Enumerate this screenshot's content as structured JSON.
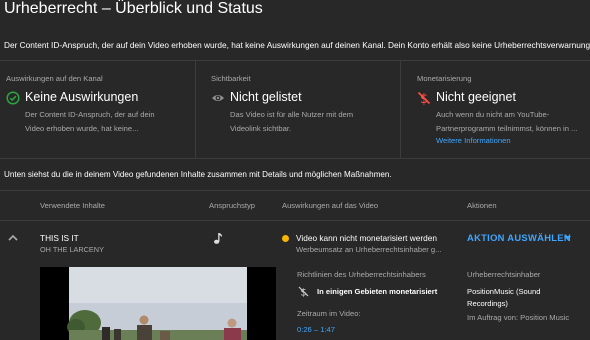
{
  "page": {
    "title": "Urheberrecht – Überblick und Status",
    "intro": "Der Content ID-Anspruch, der auf dein Video erhoben wurde, hat keine Auswirkungen auf deinen Kanal. Dein Konto erhält also keine Urheberrechtsverwarnung.",
    "found_text": "Unten siehst du die in deinem Video gefundenen Inhalte zusammen mit Details und möglichen Maßnahmen."
  },
  "cards": {
    "channel": {
      "heading": "Auswirkungen auf den Kanal",
      "icon": "check-circle-icon",
      "title": "Keine Auswirkungen",
      "desc_line1": "Der Content ID-Anspruch, der auf dein",
      "desc_line2": "Video erhoben wurde, hat keine..."
    },
    "visibility": {
      "heading": "Sichtbarkeit",
      "icon": "eye-icon",
      "title": "Nicht gelistet",
      "desc_line1": "Das Video ist für alle Nutzer mit dem",
      "desc_line2": "Videolink sichtbar."
    },
    "monetization": {
      "heading": "Monetarisierung",
      "icon": "no-money-icon",
      "title": "Nicht geeignet",
      "desc_line1": "Auch wenn du nicht am YouTube-",
      "desc_line2": "Partnerprogramm teilnimmst, können in ...",
      "link": "Weitere Informationen"
    }
  },
  "table": {
    "headers": {
      "content": "Verwendete Inhalte",
      "claim_type": "Anspruchstyp",
      "impact": "Auswirkungen auf das Video",
      "actions": "Aktionen"
    },
    "row": {
      "song": "THIS IS IT",
      "artist": "OH THE LARCENY",
      "impact_title": "Video kann nicht monetarisiert werden",
      "impact_sub": "Werbeumsatz an Urheberrechtsinhaber g...",
      "action_label": "AKTION AUSWÄHLEN",
      "policy_label": "Richtlinien des Urheberrechtsinhabers",
      "policy_value": "In einigen Gebieten monetarisiert",
      "time_label": "Zeitraum im Video:",
      "time_value": "0:26 – 1:47",
      "owner_label": "Urheberrechtsinhaber",
      "owner_line1": "PositionMusic (Sound",
      "owner_line2": "Recordings)",
      "owner_behalf": "Im Auftrag von: Position Music"
    }
  },
  "colors": {
    "background": "#282828",
    "accent_blue": "#3ea6ff",
    "status_green": "#2ba640",
    "status_red": "#ff4e45",
    "status_yellow": "#f7b500"
  }
}
